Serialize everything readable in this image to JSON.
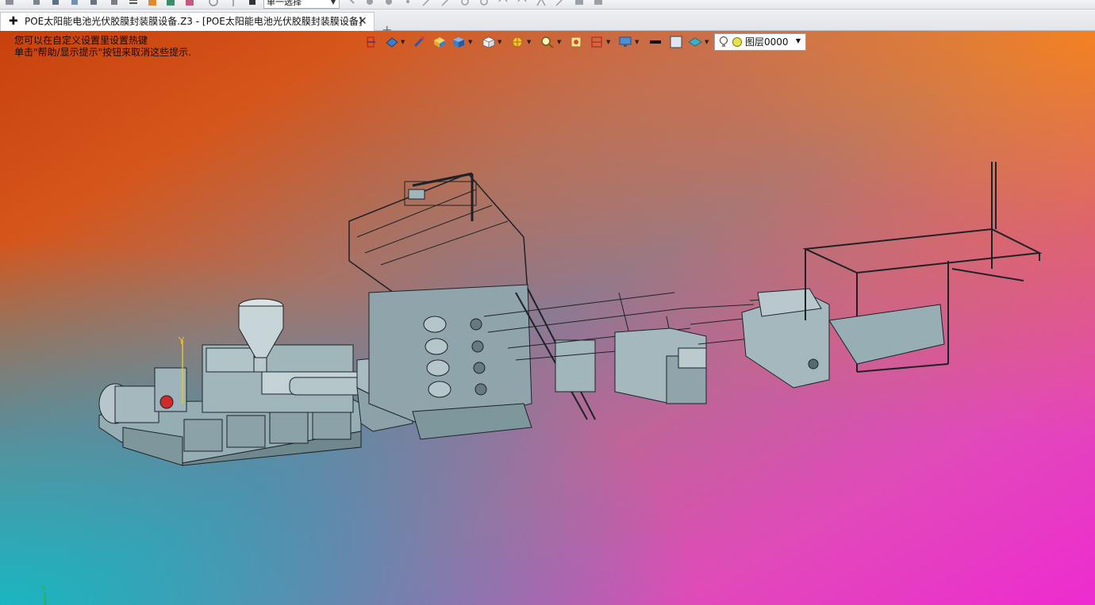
{
  "toolbar": {
    "selection_mode": "单一选择"
  },
  "tabs": [
    {
      "label": "POE太阳能电池光伏胶膜封装膜设备.Z3 - [POE太阳能电池光伏胶膜封装膜设备]"
    }
  ],
  "viewport": {
    "hint_line_1": "您可以在自定义设置里设置热键",
    "hint_line_2": "单击\"帮助/显示提示\"按钮来取消这些提示.",
    "layer": "图层0000",
    "axis_y_label": "Y",
    "background_colors": [
      "#c8410d",
      "#ee2bd0",
      "#14b9c3",
      "#ff8214"
    ],
    "model_color": "#8fa5ab"
  },
  "icons": [
    "new-icon",
    "open-icon",
    "save-icon",
    "undo-icon",
    "redo-icon",
    "view-front-icon",
    "shaded-mode-icon",
    "render-icon",
    "zoom-icon",
    "lighting-icon",
    "section-icon",
    "display-icon",
    "line-color-icon",
    "fill-color-icon",
    "layer-icon",
    "bulb-icon"
  ]
}
